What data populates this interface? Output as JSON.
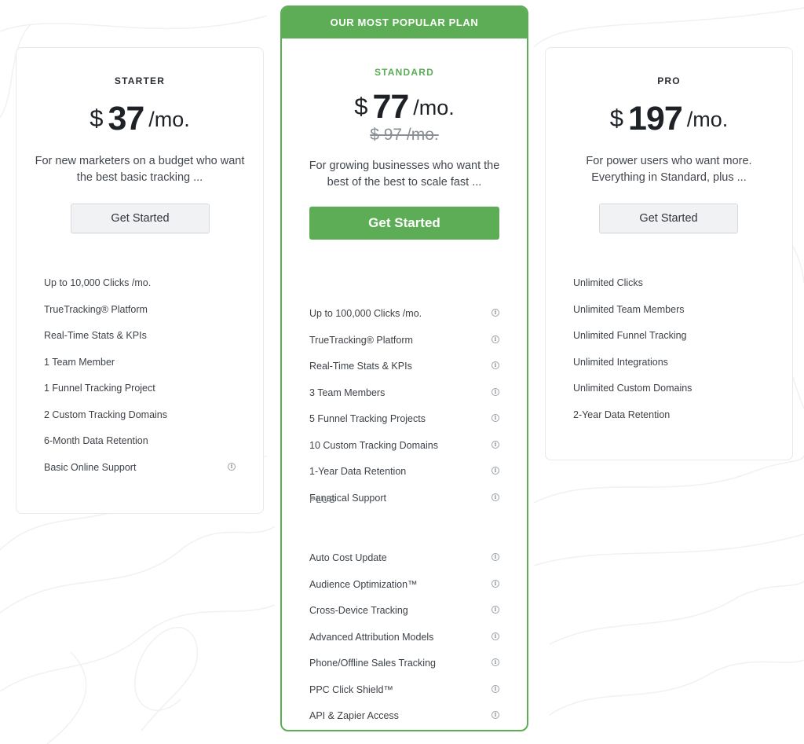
{
  "plans": {
    "starter": {
      "name": "STARTER",
      "currency": "$",
      "price": "37",
      "period": "/mo.",
      "description": "For new marketers on a budget who want the best basic tracking ...",
      "button_label": "Get Started",
      "features": [
        {
          "label": "Up to 10,000 Clicks /mo.",
          "info": false
        },
        {
          "label": "TrueTracking® Platform",
          "info": false
        },
        {
          "label": "Real-Time Stats & KPIs",
          "info": false
        },
        {
          "label": "1 Team Member",
          "info": false
        },
        {
          "label": "1 Funnel Tracking Project",
          "info": false
        },
        {
          "label": "2 Custom Tracking Domains",
          "info": false
        },
        {
          "label": "6-Month Data Retention",
          "info": false
        },
        {
          "label": "Basic Online Support",
          "info": true
        }
      ]
    },
    "standard": {
      "banner": "OUR MOST POPULAR PLAN",
      "name": "STANDARD",
      "currency": "$",
      "price": "77",
      "period": "/mo.",
      "old_price": "$ 97 /mo.",
      "description": "For growing businesses who want the best of the best to scale fast ...",
      "button_label": "Get Started",
      "features": [
        {
          "label": "Up to 100,000 Clicks /mo.",
          "info": true
        },
        {
          "label": "TrueTracking® Platform",
          "info": true
        },
        {
          "label": "Real-Time Stats & KPIs",
          "info": true
        },
        {
          "label": "3 Team Members",
          "info": true
        },
        {
          "label": "5 Funnel Tracking Projects",
          "info": true
        },
        {
          "label": "10 Custom Tracking Domains",
          "info": true
        },
        {
          "label": "1-Year Data Retention",
          "info": true
        },
        {
          "label": "Fanatical Support",
          "info": true
        }
      ],
      "plus_label": "PLUS",
      "plus_features": [
        {
          "label": "Auto Cost Update",
          "info": true
        },
        {
          "label": "Audience Optimization™",
          "info": true
        },
        {
          "label": "Cross-Device Tracking",
          "info": true
        },
        {
          "label": "Advanced Attribution Models",
          "info": true
        },
        {
          "label": "Phone/Offline Sales Tracking",
          "info": true
        },
        {
          "label": "PPC Click Shield™",
          "info": true
        },
        {
          "label": "API & Zapier Access",
          "info": true
        }
      ]
    },
    "pro": {
      "name": "PRO",
      "currency": "$",
      "price": "197",
      "period": "/mo.",
      "description": "For power users who want more. Everything in Standard, plus ...",
      "button_label": "Get Started",
      "features": [
        {
          "label": "Unlimited Clicks",
          "info": false
        },
        {
          "label": "Unlimited Team Members",
          "info": false
        },
        {
          "label": "Unlimited Funnel Tracking",
          "info": false
        },
        {
          "label": "Unlimited Integrations",
          "info": false
        },
        {
          "label": "Unlimited Custom Domains",
          "info": false
        },
        {
          "label": "2-Year Data Retention",
          "info": false
        }
      ]
    }
  },
  "icons": {
    "info": "info-icon"
  },
  "colors": {
    "accent": "#5cad55",
    "card_border": "#e7e9ec",
    "button_gray": "#f1f2f4",
    "text": "#3a3f45"
  }
}
